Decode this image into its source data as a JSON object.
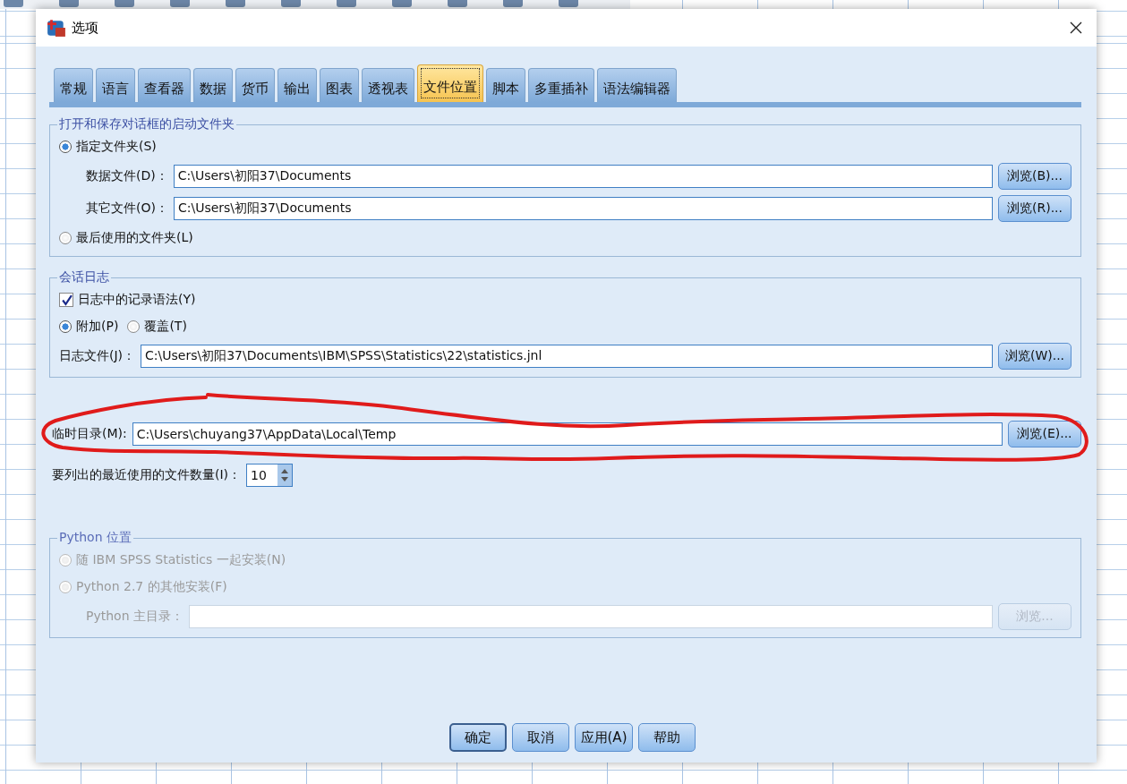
{
  "window": {
    "title": "选项"
  },
  "tabs": [
    {
      "label": "常规",
      "selected": false
    },
    {
      "label": "语言",
      "selected": false
    },
    {
      "label": "查看器",
      "selected": false
    },
    {
      "label": "数据",
      "selected": false
    },
    {
      "label": "货币",
      "selected": false
    },
    {
      "label": "输出",
      "selected": false
    },
    {
      "label": "图表",
      "selected": false
    },
    {
      "label": "透视表",
      "selected": false
    },
    {
      "label": "文件位置",
      "selected": true
    },
    {
      "label": "脚本",
      "selected": false
    },
    {
      "label": "多重插补",
      "selected": false
    },
    {
      "label": "语法编辑器",
      "selected": false
    }
  ],
  "blocks": [
    {
      "kind": "group",
      "title": "打开和保存对话框的启动文件夹",
      "disabled": false,
      "items": [
        {
          "kind": "radio",
          "label": "指定文件夹(S)",
          "selected": true
        },
        {
          "kind": "nested-path",
          "label": "数据文件(D)：",
          "value": "C:\\Users\\初阳37\\Documents",
          "button": "浏览(B)..."
        },
        {
          "kind": "nested-path",
          "label": "其它文件(O)：",
          "value": "C:\\Users\\初阳37\\Documents",
          "button": "浏览(R)..."
        },
        {
          "kind": "radio",
          "label": "最后使用的文件夹(L)",
          "selected": false
        }
      ]
    },
    {
      "kind": "group",
      "title": "会话日志",
      "disabled": false,
      "items": [
        {
          "kind": "checkbox",
          "label": "日志中的记录语法(Y)",
          "checked": true
        },
        {
          "kind": "radio-row",
          "options": [
            {
              "label": "附加(P)",
              "selected": true
            },
            {
              "label": "覆盖(T)",
              "selected": false
            }
          ]
        },
        {
          "kind": "path",
          "label": "日志文件(J)：",
          "value": "C:\\Users\\初阳37\\Documents\\IBM\\SPSS\\Statistics\\22\\statistics.jnl",
          "button": "浏览(W)..."
        }
      ]
    },
    {
      "kind": "path",
      "label": "临时目录(M):",
      "value": "C:\\Users\\chuyang37\\AppData\\Local\\Temp",
      "button": "浏览(E)...",
      "annotation": {
        "kind": "freehand-ellipse",
        "color": "#e01b1b"
      }
    },
    {
      "kind": "spinner",
      "label": "要列出的最近使用的文件数量(I)：",
      "value": "10"
    },
    {
      "kind": "group",
      "title": "Python 位置",
      "disabled": true,
      "items": [
        {
          "kind": "radio",
          "label": "随 IBM SPSS Statistics 一起安装(N)",
          "selected": false
        },
        {
          "kind": "radio",
          "label": "Python 2.7 的其他安装(F)",
          "selected": false
        },
        {
          "kind": "nested-path",
          "label": "Python 主目录：",
          "button": "浏览..."
        }
      ]
    }
  ],
  "buttons": [
    {
      "label": "确定",
      "default": true
    },
    {
      "label": "取消",
      "default": false
    },
    {
      "label": "应用(A)",
      "default": false
    },
    {
      "label": "帮助",
      "default": false
    }
  ]
}
